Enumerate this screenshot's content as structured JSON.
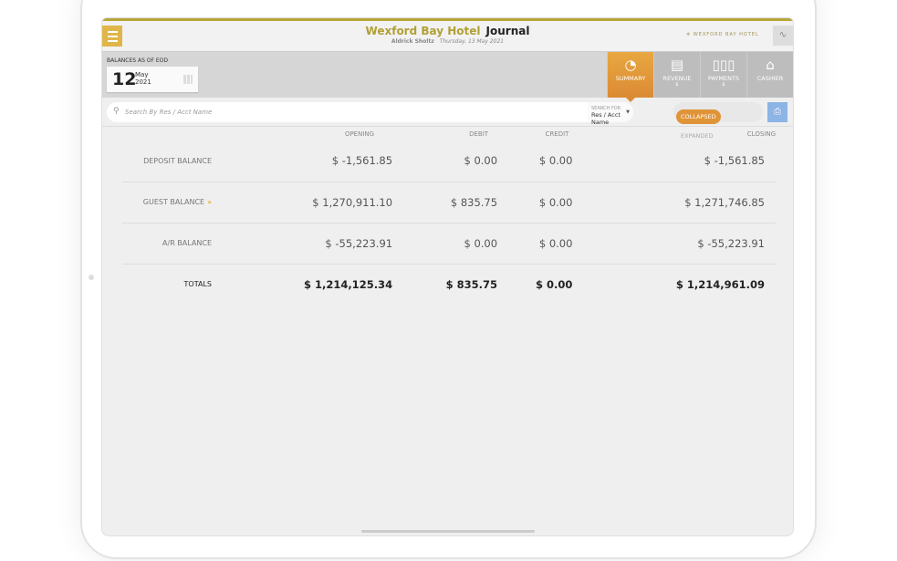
{
  "header": {
    "hotel": "Wexford Bay Hotel",
    "page": "Journal",
    "user": "Aldrick Sholtz",
    "date": "Thursday, 13 May 2021",
    "logo_text": "WEXFORD BAY HOTEL"
  },
  "eod": {
    "label": "BALANCES AS OF EOD",
    "day": "12",
    "month": "May",
    "year": "2021"
  },
  "tabs": [
    {
      "label": "SUMMARY",
      "sub": "",
      "icon": "summary-icon"
    },
    {
      "label": "REVENUE",
      "sub": "$",
      "icon": "receipt-icon"
    },
    {
      "label": "PAYMENTS",
      "sub": "$",
      "icon": "bar-chart-icon"
    },
    {
      "label": "CASHIER",
      "sub": "",
      "icon": "cash-register-icon"
    }
  ],
  "search": {
    "placeholder": "Search By Res / Acct Name",
    "for_label": "SEARCH FOR",
    "for_value": "Res / Acct Name"
  },
  "toggle": {
    "collapsed": "COLLAPSED",
    "expanded": "EXPANDED"
  },
  "table": {
    "columns": [
      "OPENING",
      "DEBIT",
      "CREDIT",
      "CLOSING"
    ],
    "rows": [
      {
        "label": "DEPOSIT BALANCE",
        "values": [
          "$ -1,561.85",
          "$ 0.00",
          "$ 0.00",
          "$ -1,561.85"
        ]
      },
      {
        "label": "GUEST BALANCE",
        "values": [
          "$ 1,270,911.10",
          "$ 835.75",
          "$ 0.00",
          "$ 1,271,746.85"
        ]
      },
      {
        "label": "A/R BALANCE",
        "values": [
          "$ -55,223.91",
          "$ 0.00",
          "$ 0.00",
          "$ -55,223.91"
        ]
      }
    ],
    "totals": {
      "label": "TOTALS",
      "values": [
        "$ 1,214,125.34",
        "$ 835.75",
        "$ 0.00",
        "$ 1,214,961.09"
      ]
    }
  }
}
